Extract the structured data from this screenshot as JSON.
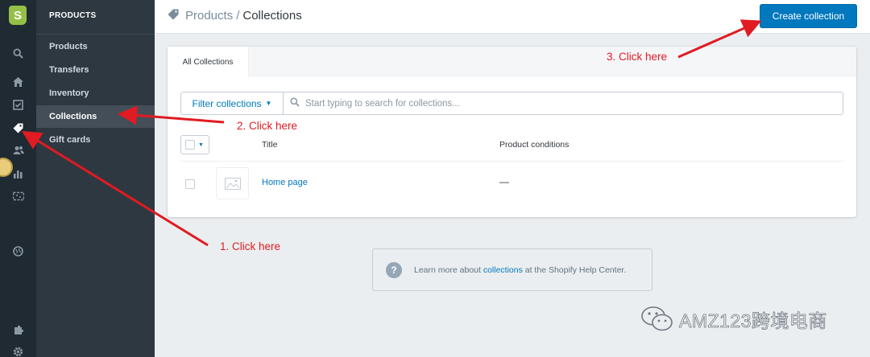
{
  "rail": {
    "icons": [
      "shopify-logo-icon",
      "search-icon",
      "home-icon",
      "orders-icon",
      "products-tag-icon",
      "customers-icon",
      "analytics-icon",
      "discounts-icon",
      "online-store-icon",
      "apps-icon",
      "settings-icon"
    ],
    "active": "products-tag-icon",
    "logo_letter": "S"
  },
  "subnav": {
    "heading": "PRODUCTS",
    "items": [
      {
        "label": "Products"
      },
      {
        "label": "Transfers"
      },
      {
        "label": "Inventory"
      },
      {
        "label": "Collections",
        "active": true
      },
      {
        "label": "Gift cards"
      }
    ]
  },
  "header": {
    "breadcrumb_parent": "Products",
    "breadcrumb_separator": "/",
    "breadcrumb_current": "Collections",
    "create_button": "Create collection"
  },
  "card": {
    "tab": "All Collections",
    "filter_button": "Filter collections",
    "search_placeholder": "Start typing to search for collections...",
    "columns": {
      "title": "Title",
      "conditions": "Product conditions"
    },
    "rows": [
      {
        "title": "Home page",
        "conditions": "—"
      }
    ]
  },
  "help": {
    "prefix": "Learn more about ",
    "link": "collections",
    "suffix": " at the Shopify Help Center."
  },
  "annotations": {
    "step1": "1. Click here",
    "step2": "2. Click here",
    "step3": "3. Click here"
  },
  "watermark": "AMZ123跨境电商",
  "colors": {
    "accent": "#0078bd",
    "annotation": "#e01b22",
    "rail_bg": "#1f2a33",
    "subnav_bg": "#2e3841"
  }
}
